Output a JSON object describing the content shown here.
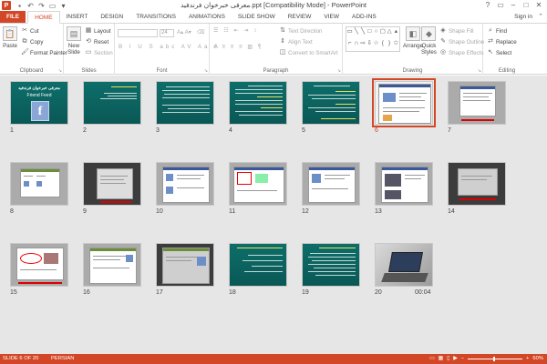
{
  "window": {
    "title": "معرفی خبرخوان فرندفید.ppt [Compatibility Mode] - PowerPoint",
    "app_icon": "P",
    "controls": [
      "?",
      "▭",
      "–",
      "□",
      "✕"
    ]
  },
  "qat": [
    "save-icon",
    "undo-icon",
    "redo-icon",
    "start-from-beginning-icon",
    "customize-icon"
  ],
  "tabs": [
    "FILE",
    "HOME",
    "INSERT",
    "DESIGN",
    "TRANSITIONS",
    "ANIMATIONS",
    "SLIDE SHOW",
    "REVIEW",
    "VIEW",
    "ADD-INS"
  ],
  "active_tab": "HOME",
  "signin": "Sign in",
  "ribbon": {
    "clipboard": {
      "label": "Clipboard",
      "paste": "Paste",
      "cut": "Cut",
      "copy": "Copy",
      "format_painter": "Format Painter"
    },
    "slides": {
      "label": "Slides",
      "new_slide": "New",
      "new_slide2": "Slide",
      "layout": "Layout",
      "reset": "Reset",
      "section": "Section"
    },
    "font": {
      "label": "Font",
      "size": "24"
    },
    "paragraph": {
      "label": "Paragraph",
      "text_direction": "Text Direction",
      "align_text": "Align Text",
      "convert_smartart": "Convert to SmartArt"
    },
    "drawing": {
      "label": "Drawing",
      "arrange": "Arrange",
      "quick_styles": "Quick",
      "quick_styles2": "Styles",
      "shape_fill": "Shape Fill",
      "shape_outline": "Shape Outline",
      "shape_effects": "Shape Effects"
    },
    "editing": {
      "label": "Editing",
      "find": "Find",
      "replace": "Replace",
      "select": "Select"
    }
  },
  "slides": [
    {
      "num": "1",
      "kind": "title",
      "title": "معرفی خبرخوان فرندفید",
      "subtitle": "Friend Feed",
      "logo": "f"
    },
    {
      "num": "2",
      "kind": "teal-text"
    },
    {
      "num": "3",
      "kind": "teal-text"
    },
    {
      "num": "4",
      "kind": "teal-text"
    },
    {
      "num": "5",
      "kind": "teal-text"
    },
    {
      "num": "6",
      "kind": "shot",
      "selected": true
    },
    {
      "num": "7",
      "kind": "shot"
    },
    {
      "num": "8",
      "kind": "shot"
    },
    {
      "num": "9",
      "kind": "shot-dark"
    },
    {
      "num": "10",
      "kind": "shot"
    },
    {
      "num": "11",
      "kind": "shot"
    },
    {
      "num": "12",
      "kind": "shot"
    },
    {
      "num": "13",
      "kind": "shot"
    },
    {
      "num": "14",
      "kind": "shot-dark"
    },
    {
      "num": "15",
      "kind": "shot"
    },
    {
      "num": "16",
      "kind": "shot"
    },
    {
      "num": "17",
      "kind": "shot-dark"
    },
    {
      "num": "18",
      "kind": "teal-text"
    },
    {
      "num": "19",
      "kind": "teal-text"
    },
    {
      "num": "20",
      "kind": "laptop",
      "time": "00:04"
    }
  ],
  "status": {
    "slide_info": "SLIDE 6 OF 20",
    "language": "PERSIAN",
    "zoom": "60%"
  },
  "colors": {
    "accent": "#d24726",
    "slide_teal": "#0d6e69",
    "sorter_bg": "#e6e6e6"
  }
}
